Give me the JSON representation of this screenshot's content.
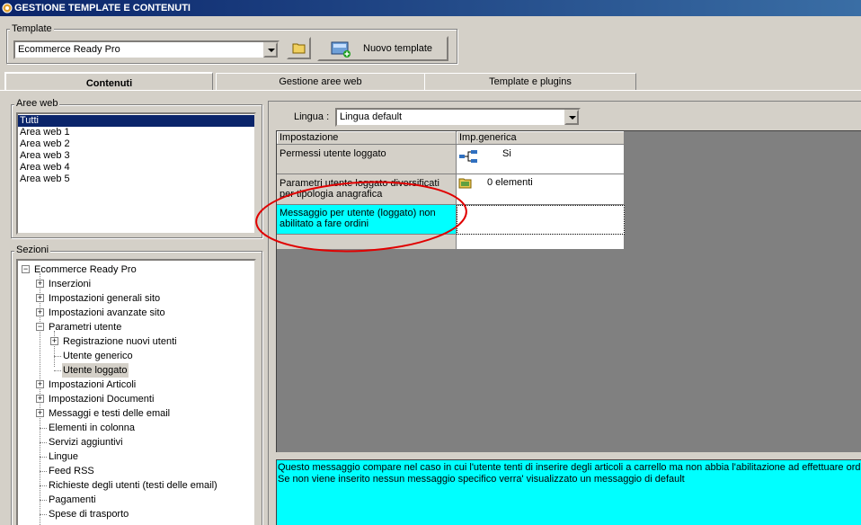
{
  "window": {
    "title": "GESTIONE TEMPLATE E CONTENUTI"
  },
  "template": {
    "group_label": "Template",
    "selected": "Ecommerce Ready Pro",
    "new_button_label": "Nuovo template"
  },
  "tabs": [
    {
      "label": "Contenuti",
      "active": true
    },
    {
      "label": "Gestione aree web",
      "active": false
    },
    {
      "label": "Template e plugins",
      "active": false
    }
  ],
  "aree_web": {
    "label": "Aree web",
    "items": [
      "Tutti",
      "Area web 1",
      "Area web 2",
      "Area web 3",
      "Area web 4",
      "Area web 5"
    ],
    "selected": "Tutti"
  },
  "sezioni": {
    "label": "Sezioni",
    "tree": [
      {
        "label": "Ecommerce Ready Pro",
        "level": 0,
        "expander": "-"
      },
      {
        "label": "Inserzioni",
        "level": 1,
        "expander": "+"
      },
      {
        "label": "Impostazioni generali sito",
        "level": 1,
        "expander": "+"
      },
      {
        "label": "Impostazioni avanzate sito",
        "level": 1,
        "expander": "+"
      },
      {
        "label": "Parametri utente",
        "level": 1,
        "expander": "-"
      },
      {
        "label": "Registrazione nuovi utenti",
        "level": 2,
        "expander": "+"
      },
      {
        "label": "Utente generico",
        "level": 2,
        "expander": ""
      },
      {
        "label": "Utente loggato",
        "level": 2,
        "expander": "",
        "selected": true
      },
      {
        "label": "Impostazioni Articoli",
        "level": 1,
        "expander": "+"
      },
      {
        "label": "Impostazioni Documenti",
        "level": 1,
        "expander": "+"
      },
      {
        "label": "Messaggi e testi delle email",
        "level": 1,
        "expander": "+"
      },
      {
        "label": "Elementi in colonna",
        "level": 1,
        "expander": ""
      },
      {
        "label": "Servizi aggiuntivi",
        "level": 1,
        "expander": ""
      },
      {
        "label": "Lingue",
        "level": 1,
        "expander": ""
      },
      {
        "label": "Feed RSS",
        "level": 1,
        "expander": ""
      },
      {
        "label": "Richieste degli utenti (testi delle email)",
        "level": 1,
        "expander": ""
      },
      {
        "label": "Pagamenti",
        "level": 1,
        "expander": ""
      },
      {
        "label": "Spese di trasporto",
        "level": 1,
        "expander": ""
      }
    ]
  },
  "lingua": {
    "label": "Lingua :",
    "selected": "Lingua default"
  },
  "grid": {
    "columns": [
      "Impostazione",
      "Imp.generica"
    ],
    "rows": [
      {
        "setting": "Permessi utente loggato",
        "value": "Si",
        "icon": "network-icon"
      },
      {
        "setting": "Parametri utente loggato diversificati per tipologia anagrafica",
        "value": "0 elementi",
        "icon": "folder-icon"
      },
      {
        "setting": "Messaggio per utente (loggato) non abilitato a fare ordini",
        "value": "",
        "icon": "",
        "selected": true
      }
    ]
  },
  "description": {
    "line1": "Questo messaggio compare nel caso in cui l'utente tenti di inserire degli articoli a carrello ma non abbia l'abilitazione ad effettuare ordini.",
    "line2": "Se non viene inserito nessun messaggio specifico verra' visualizzato un messaggio di default"
  },
  "colors": {
    "titlebar": "#0a246a",
    "selection": "#0a246a",
    "highlight_cyan": "#00ffff",
    "grid_background": "#808080",
    "annotation_red": "#e00000"
  }
}
